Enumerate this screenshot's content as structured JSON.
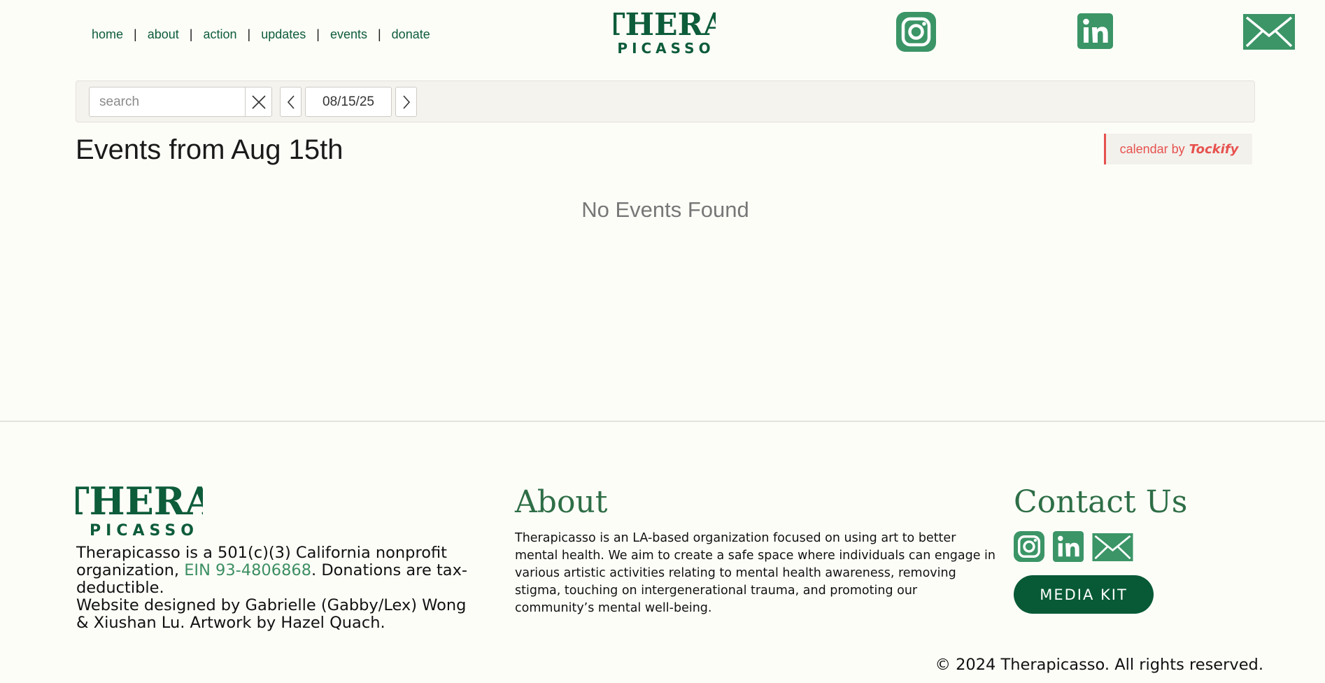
{
  "colors": {
    "brand_green": "#0d5c3a",
    "icon_green": "#3b9566",
    "accent_red": "#e6524f",
    "heading_green": "#2e6e46",
    "background": "#fdfdf8"
  },
  "header": {
    "nav": [
      {
        "label": "home"
      },
      {
        "label": "about"
      },
      {
        "label": "action"
      },
      {
        "label": "updates"
      },
      {
        "label": "events"
      },
      {
        "label": "donate"
      }
    ],
    "separator": "|",
    "logo": {
      "line1": "THERA",
      "line2": "PICASSO"
    },
    "social_icons": [
      "instagram-icon",
      "linkedin-icon",
      "mail-icon"
    ]
  },
  "calendar": {
    "search_placeholder": "search",
    "date": "08/15/25",
    "heading": "Events from Aug 15th",
    "badge_prefix": "calendar by",
    "badge_brand": "Tockify",
    "empty_message": "No Events Found"
  },
  "footer": {
    "logo": {
      "line1": "THERA",
      "line2": "PICASSO"
    },
    "org_text_1": "Therapicasso is a 501(c)(3) California nonprofit organization, ",
    "ein_link": "EIN 93-4806868",
    "org_text_2": ". Donations are tax-deductible.",
    "credits": "Website designed by Gabrielle (Gabby/Lex) Wong & Xiushan Lu. Artwork by Hazel Quach.",
    "about_heading": "About",
    "about_text": "Therapicasso is an LA-based organization focused on using art to better mental health. We aim to create a safe space where individuals can engage in various artistic activities relating to mental health awareness, removing stigma, touching on intergenerational trauma, and promoting our community’s mental well-being.",
    "contact_heading": "Contact Us",
    "media_kit": "MEDIA KIT",
    "copyright": "© 2024 Therapicasso. All rights reserved."
  }
}
